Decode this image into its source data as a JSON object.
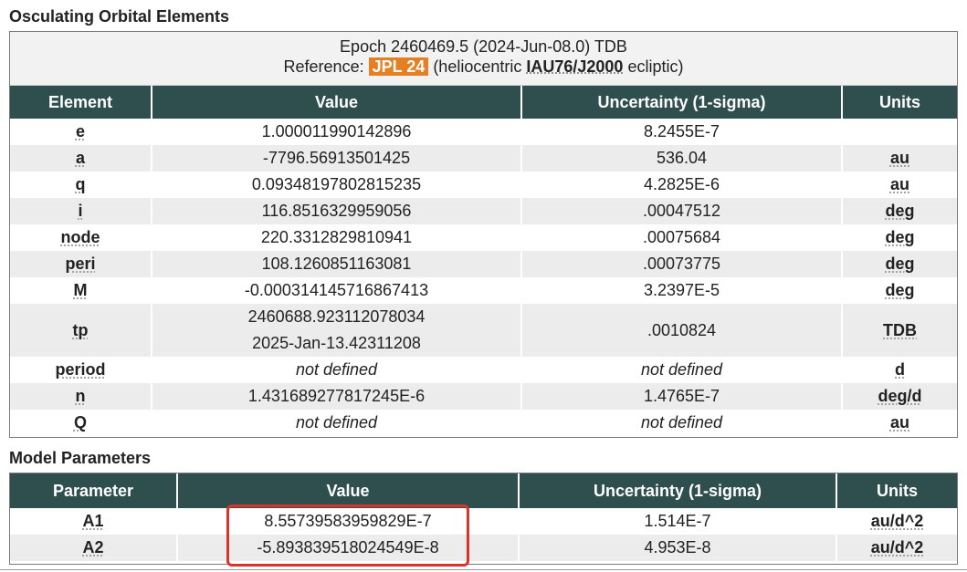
{
  "orbital": {
    "title": "Osculating Orbital Elements",
    "epoch_line": "Epoch 2460469.5 (2024-Jun-08.0) TDB",
    "ref_prefix": "Reference: ",
    "ref_badge": "JPL 24",
    "ref_mid": " (heliocentric ",
    "ref_frame": "IAU76/J2000",
    "ref_suffix": " ecliptic)",
    "headers": [
      "Element",
      "Value",
      "Uncertainty (1-sigma)",
      "Units"
    ],
    "rows": [
      {
        "element": "e",
        "value": "1.000011990142896",
        "uncertainty": "8.2455E-7",
        "units": ""
      },
      {
        "element": "a",
        "value": "-7796.56913501425",
        "uncertainty": "536.04",
        "units": "au"
      },
      {
        "element": "q",
        "value": "0.09348197802815235",
        "uncertainty": "4.2825E-6",
        "units": "au"
      },
      {
        "element": "i",
        "value": "116.8516329959056",
        "uncertainty": ".00047512",
        "units": "deg"
      },
      {
        "element": "node",
        "value": "220.3312829810941",
        "uncertainty": ".00075684",
        "units": "deg"
      },
      {
        "element": "peri",
        "value": "108.1260851163081",
        "uncertainty": ".00073775",
        "units": "deg"
      },
      {
        "element": "M",
        "value": "-0.00031414571686741​3",
        "uncertainty": "3.2397E-5",
        "units": "deg"
      },
      {
        "element": "tp",
        "value": "2460688.923112078034",
        "value2": "2025-Jan-13.42311208",
        "uncertainty": ".0010824",
        "units": "TDB"
      },
      {
        "element": "period",
        "value": "not defined",
        "uncertainty": "not defined",
        "units": "d"
      },
      {
        "element": "n",
        "value": "1.43168927781724​5E-6",
        "uncertainty": "1.4765E-7",
        "units": "deg/d"
      },
      {
        "element": "Q",
        "value": "not defined",
        "uncertainty": "not defined",
        "units": "au"
      }
    ]
  },
  "model": {
    "title": "Model Parameters",
    "headers": [
      "Parameter",
      "Value",
      "Uncertainty (1-sigma)",
      "Units"
    ],
    "rows": [
      {
        "parameter": "A1",
        "value": "8.55739583959829E-7",
        "uncertainty": "1.514E-7",
        "units": "au/d^2"
      },
      {
        "parameter": "A2",
        "value": "-5.893839518024549E-8",
        "uncertainty": "4.953E-8",
        "units": "au/d^2"
      }
    ]
  },
  "colors": {
    "header_bg": "#2f4f4f",
    "ref_badge": "#e67e22",
    "highlight": "#d9342b"
  }
}
